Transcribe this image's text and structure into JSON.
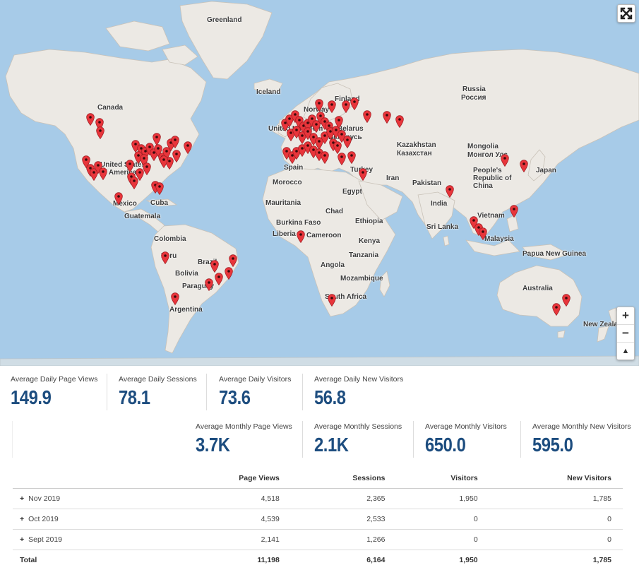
{
  "map": {
    "labels": [
      "Greenland",
      "Iceland",
      "Canada",
      "Finland",
      "Norway",
      "Russia",
      "Россия",
      "United Kingdom",
      "Belarus",
      "Беларусь",
      "Kazakhstan",
      "Казахстан",
      "Mongolia",
      "Монгол Улс",
      "United States of America",
      "Spain",
      "Turkey",
      "People's Republic of China",
      "Japan",
      "Morocco",
      "Iran",
      "Pakistan",
      "Egypt",
      "Mexico",
      "Cuba",
      "India",
      "Mauritania",
      "Chad",
      "Guatemala",
      "Vietnam",
      "Burkina Faso",
      "Ethiopia",
      "Sri Lanka",
      "Liberia",
      "Cameroon",
      "Kenya",
      "Malaysia",
      "Colombia",
      "Tanzania",
      "Papua New Guinea",
      "Peru",
      "Brazil",
      "Angola",
      "Bolivia",
      "Mozambique",
      "Paraguay",
      "Australia",
      "South Africa",
      "Argentina",
      "New Zealand"
    ],
    "zoom_in": "+",
    "zoom_out": "−",
    "reset_north": "▲"
  },
  "stats_daily": [
    {
      "label": "Average Daily Page Views",
      "value": "149.9"
    },
    {
      "label": "Average Daily Sessions",
      "value": "78.1"
    },
    {
      "label": "Average Daily Visitors",
      "value": "73.6"
    },
    {
      "label": "Average Daily New Visitors",
      "value": "56.8"
    }
  ],
  "stats_monthly": [
    {
      "label": "Average Monthly Page Views",
      "value": "3.7K"
    },
    {
      "label": "Average Monthly Sessions",
      "value": "2.1K"
    },
    {
      "label": "Average Monthly Visitors",
      "value": "650.0"
    },
    {
      "label": "Average Monthly New Visitors",
      "value": "595.0"
    }
  ],
  "table": {
    "headers": [
      "",
      "Page Views",
      "Sessions",
      "Visitors",
      "New Visitors"
    ],
    "rows": [
      {
        "period": "Nov 2019",
        "page_views": "4,518",
        "sessions": "2,365",
        "visitors": "1,950",
        "new_visitors": "1,785"
      },
      {
        "period": "Oct 2019",
        "page_views": "4,539",
        "sessions": "2,533",
        "visitors": "0",
        "new_visitors": "0"
      },
      {
        "period": "Sept 2019",
        "page_views": "2,141",
        "sessions": "1,266",
        "visitors": "0",
        "new_visitors": "0"
      }
    ],
    "total": {
      "label": "Total",
      "page_views": "11,198",
      "sessions": "6,164",
      "visitors": "1,950",
      "new_visitors": "1,785"
    },
    "expand_symbol": "+"
  },
  "colors": {
    "marker": "#e8353b",
    "value_text": "#1d4d7f",
    "ocean": "#a7cbe8",
    "land": "#ece9e4"
  }
}
